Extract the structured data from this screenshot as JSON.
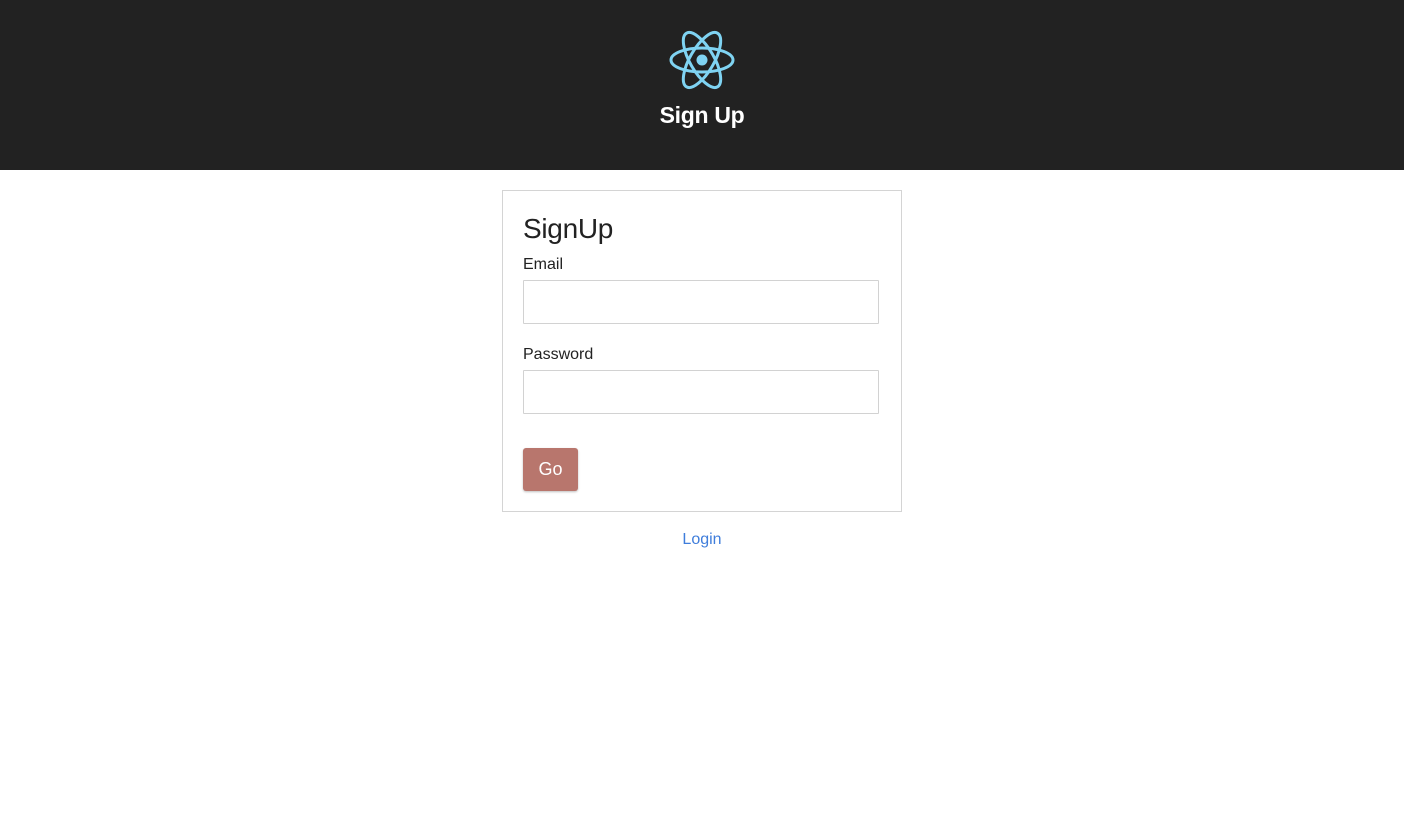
{
  "header": {
    "logo_icon": "react-atom-icon",
    "logo_color": "#7fd3f2",
    "title": "Sign Up",
    "background": "#222222"
  },
  "form": {
    "title": "SignUp",
    "email": {
      "label": "Email",
      "value": "",
      "placeholder": ""
    },
    "password": {
      "label": "Password",
      "value": "",
      "placeholder": ""
    },
    "submit_label": "Go",
    "submit_color": "#b8766d"
  },
  "footer": {
    "login_link": "Login",
    "link_color": "#3f7ddb"
  }
}
